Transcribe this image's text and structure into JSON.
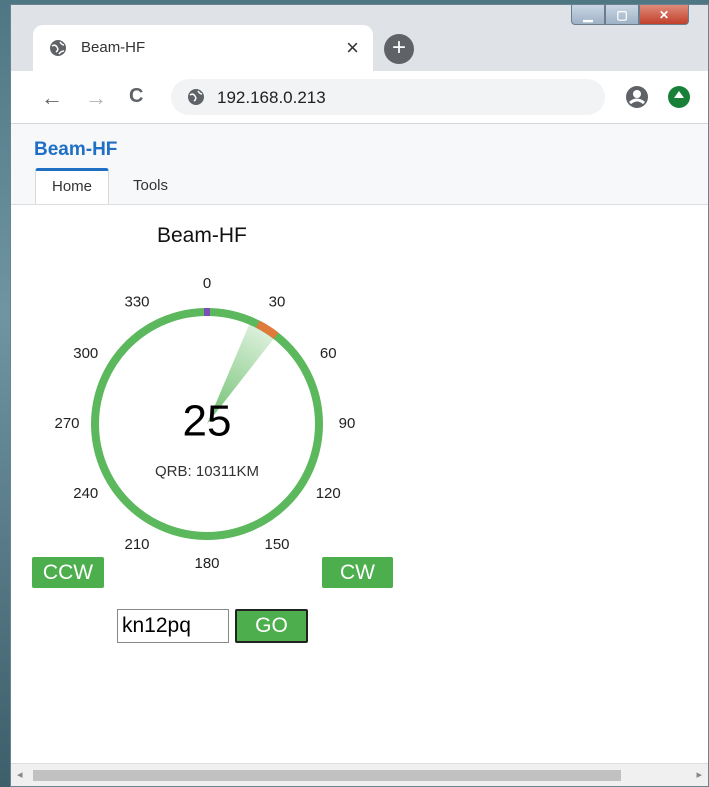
{
  "browser": {
    "tab_title": "Beam-HF",
    "tab_close": "×",
    "new_tab": "+",
    "url": "192.168.0.213",
    "back": "←",
    "forward": "→",
    "reload": "C"
  },
  "app": {
    "brand": "Beam-HF",
    "tabs": [
      {
        "label": "Home",
        "active": true
      },
      {
        "label": "Tools",
        "active": false
      }
    ],
    "page_title": "Beam-HF"
  },
  "compass": {
    "heading_deg": 25,
    "heading_text": "25",
    "qrb_text": "QRB: 10311KM",
    "labels": [
      "0",
      "30",
      "60",
      "90",
      "120",
      "150",
      "180",
      "210",
      "240",
      "270",
      "300",
      "330"
    ],
    "ring_color": "#5cb85c",
    "marker_color": "#e07a3a"
  },
  "controls": {
    "ccw_label": "CCW",
    "cw_label": "CW",
    "locator_value": "kn12pq",
    "go_label": "GO"
  },
  "scrollbar": {
    "left": "◂",
    "right": "▸"
  }
}
